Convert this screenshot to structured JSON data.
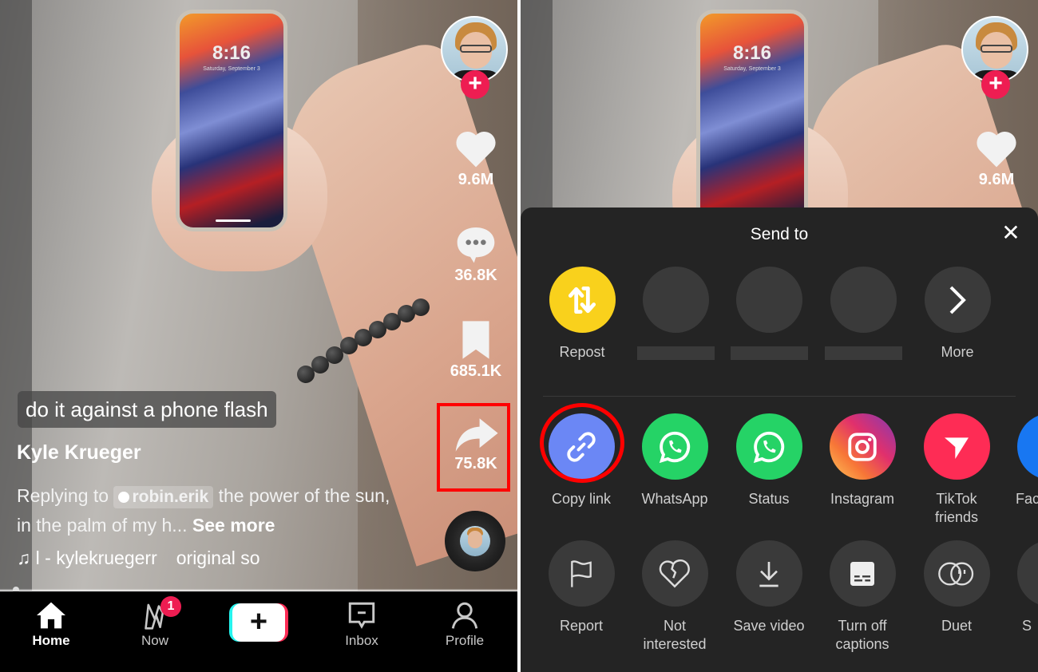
{
  "left": {
    "video": {
      "phone_time": "8:16",
      "phone_date": "Saturday, September 3",
      "caption": "do it against a phone flash",
      "author": "Kyle Krueger",
      "description_prefix": "Replying to",
      "mention": "robin.erik",
      "description_text": "the power of the sun, in the palm of my h...",
      "see_more": "See more",
      "music_author": "l - kylekruegerr",
      "music_title": "original so"
    },
    "actions": {
      "likes": "9.6M",
      "comments": "36.8K",
      "saves": "685.1K",
      "shares": "75.8K"
    },
    "nav": {
      "home": "Home",
      "now": "Now",
      "now_badge": "1",
      "create": "+",
      "inbox": "Inbox",
      "profile": "Profile"
    }
  },
  "right": {
    "actions": {
      "likes": "9.6M"
    },
    "sheet": {
      "title": "Send to",
      "close": "✕",
      "row1": [
        {
          "label": "Repost",
          "icon": "repost-icon",
          "color": "#f9d11c"
        },
        {
          "label": "",
          "icon": "placeholder-contact"
        },
        {
          "label": "",
          "icon": "placeholder-contact"
        },
        {
          "label": "",
          "icon": "placeholder-contact"
        },
        {
          "label": "More",
          "icon": "chevron-right-icon"
        }
      ],
      "row2": [
        {
          "label": "Copy link",
          "icon": "link-icon",
          "color": "#6b87f5"
        },
        {
          "label": "WhatsApp",
          "icon": "whatsapp-icon",
          "color": "#25d366"
        },
        {
          "label": "Status",
          "icon": "whatsapp-status-icon",
          "color": "#25d366"
        },
        {
          "label": "Instagram",
          "icon": "instagram-icon"
        },
        {
          "label": "TikTok friends",
          "icon": "send-icon",
          "color": "#fe2c55"
        },
        {
          "label": "Fac",
          "icon": "facebook-icon",
          "color": "#1877f2"
        }
      ],
      "row3": [
        {
          "label": "Report",
          "icon": "flag-icon"
        },
        {
          "label": "Not interested",
          "icon": "broken-heart-icon"
        },
        {
          "label": "Save video",
          "icon": "download-icon"
        },
        {
          "label": "Turn off captions",
          "icon": "captions-icon"
        },
        {
          "label": "Duet",
          "icon": "duet-icon"
        },
        {
          "label": "S",
          "icon": "stitch-icon"
        }
      ]
    }
  },
  "colors": {
    "accent_red": "#ee1d52",
    "highlight": "#ff0000",
    "sheet_bg": "#242424"
  }
}
